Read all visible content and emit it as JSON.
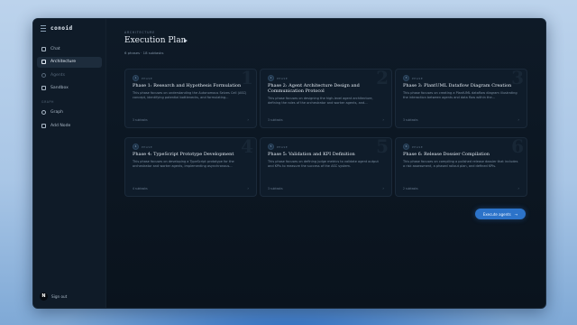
{
  "app": {
    "brand": "conoid"
  },
  "sidebar": {
    "items": [
      {
        "label": "Chat",
        "icon": "chat-icon"
      },
      {
        "label": "Architecture",
        "icon": "layers-icon",
        "active": true
      },
      {
        "label": "Agents",
        "icon": "agents-icon",
        "dimmed": true
      },
      {
        "label": "Sandbox",
        "icon": "sandbox-icon"
      }
    ],
    "section_label": "GRAPH",
    "graph_items": [
      {
        "label": "Graph",
        "icon": "graph-icon"
      },
      {
        "label": "Add Node",
        "icon": "add-node-icon"
      }
    ],
    "user": {
      "avatar_letter": "N",
      "signout_label": "Sign out"
    }
  },
  "header": {
    "eyebrow": "ARCHITECTURE",
    "title": "Execution Plan",
    "subtitle": "6 phases · 18 subtasks"
  },
  "phases": [
    {
      "number": "1",
      "label": "PHASE",
      "title": "Phase 1: Research and Hypothesis Formulation",
      "desc": "This phase focuses on understanding the Autonomous Selves Cell (ASC) concept, identifying potential bottlenecks, and formulating...",
      "subtasks": "3 subtasks"
    },
    {
      "number": "2",
      "label": "PHASE",
      "title": "Phase 2: Agent Architecture Design and Communication Protocol",
      "desc": "This phase focuses on designing the high-level agent architecture, defining the roles of the orchestrator and worker agents, and...",
      "subtasks": "3 subtasks"
    },
    {
      "number": "3",
      "label": "PHASE",
      "title": "Phase 3: PlantUML Dataflow Diagram Creation",
      "desc": "This phase focuses on creating a PlantUML dataflow diagram illustrating the interaction between agents and data flow within the...",
      "subtasks": "3 subtasks"
    },
    {
      "number": "4",
      "label": "PHASE",
      "title": "Phase 4: TypeScript Prototype Development",
      "desc": "This phase focuses on developing a TypeScript prototype for the orchestrator and worker agents, implementing asynchronous...",
      "subtasks": "4 subtasks"
    },
    {
      "number": "5",
      "label": "PHASE",
      "title": "Phase 5: Validation and KPI Definition",
      "desc": "This phase focuses on defining judge metrics to validate agent output and KPIs to measure the success of the ASC system.",
      "subtasks": "3 subtasks"
    },
    {
      "number": "6",
      "label": "PHASE",
      "title": "Phase 6: Release Dossier Compilation",
      "desc": "This phase focuses on compiling a polished release dossier that includes a risk assessment, a phased rollout plan, and defined KPIs.",
      "subtasks": "2 subtasks"
    }
  ],
  "actions": {
    "execute_label": "Execute agents"
  },
  "colors": {
    "accent": "#2c73c9",
    "window_bg": "#0b1520",
    "card_bg": "#0f1c2a"
  }
}
